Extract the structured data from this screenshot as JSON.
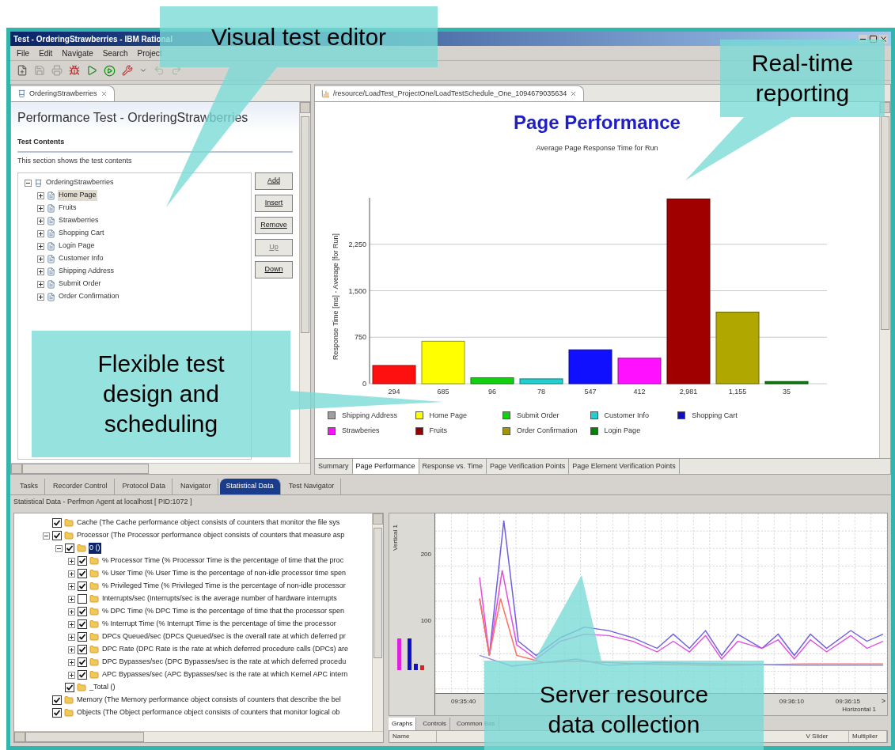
{
  "window": {
    "title": "Test - OrderingStrawberries - IBM Rational"
  },
  "menu": [
    "File",
    "Edit",
    "Navigate",
    "Search",
    "Project"
  ],
  "test_editor": {
    "tab": "OrderingStrawberries",
    "heading": "Performance Test - OrderingStrawberries",
    "section_title": "Test Contents",
    "section_description": "This section shows the test contents",
    "tree": {
      "label": "OrderingStrawberries",
      "expanded": true,
      "selected": false,
      "children": [
        {
          "label": "Home Page",
          "expanded": false,
          "selected": true
        },
        {
          "label": "Fruits",
          "expanded": false,
          "selected": false
        },
        {
          "label": "Strawberries",
          "expanded": false,
          "selected": false
        },
        {
          "label": "Shopping Cart",
          "expanded": false,
          "selected": false
        },
        {
          "label": "Login Page",
          "expanded": false,
          "selected": false
        },
        {
          "label": "Customer Info",
          "expanded": false,
          "selected": false
        },
        {
          "label": "Shipping Address",
          "expanded": false,
          "selected": false
        },
        {
          "label": "Submit Order",
          "expanded": false,
          "selected": false
        },
        {
          "label": "Order Confirmation",
          "expanded": false,
          "selected": false
        }
      ]
    },
    "buttons": [
      {
        "label": "Add",
        "disabled": false
      },
      {
        "label": "Insert",
        "disabled": false
      },
      {
        "label": "Remove",
        "disabled": false
      },
      {
        "label": "Up",
        "disabled": true
      },
      {
        "label": "Down",
        "disabled": false
      }
    ]
  },
  "report_editor": {
    "tab": "/resource/LoadTest_ProjectOne/LoadTestSchedule_One_1094679035634",
    "title": "Page Performance",
    "chart_data": {
      "type": "bar",
      "title": "Average Page Response Time for Run",
      "ylabel": "Response Time [ms] - Average [for Run]",
      "values": [
        294,
        685,
        96,
        78,
        547,
        412,
        2981,
        1155,
        35
      ],
      "value_labels": [
        "294",
        "685",
        "96",
        "78",
        "547",
        "412",
        "2,981",
        "1,155",
        "35"
      ],
      "ylim": [
        0,
        3000
      ],
      "grid": true,
      "yticks": [
        0,
        750,
        {
          "value": 1500,
          "label": "1,500"
        },
        {
          "value": 2250,
          "label": "2,250"
        }
      ]
    },
    "legend": [
      {
        "label": "Shipping Address",
        "color": "#a0a0a0"
      },
      {
        "label": "Home Page",
        "color": "#ffff00"
      },
      {
        "label": "Submit Order",
        "color": "#10d010"
      },
      {
        "label": "Customer Info",
        "color": "#20d0d0"
      },
      {
        "label": "Shopping Cart",
        "color": "#1010c0"
      },
      {
        "label": "Strawberies",
        "color": "#ff10ff"
      },
      {
        "label": "Fruits",
        "color": "#900000"
      },
      {
        "label": "Order Confirmation",
        "color": "#a09800"
      },
      {
        "label": "Login Page",
        "color": "#008000"
      }
    ],
    "tabs": [
      {
        "label": "Summary",
        "selected": false
      },
      {
        "label": "Page Performance",
        "selected": true
      },
      {
        "label": "Response vs. Time",
        "selected": false
      },
      {
        "label": "Page Verification Points",
        "selected": false
      },
      {
        "label": "Page Element Verification Points",
        "selected": false
      }
    ]
  },
  "bottom_panel": {
    "tabs": [
      {
        "label": "Tasks",
        "selected": false
      },
      {
        "label": "Recorder Control",
        "selected": false
      },
      {
        "label": "Protocol Data",
        "selected": false
      },
      {
        "label": "Navigator",
        "selected": false
      },
      {
        "label": "Statistical Data",
        "selected": true
      },
      {
        "label": "Test Navigator",
        "selected": false
      }
    ],
    "header": "Statistical Data - Perfmon Agent at localhost [ PID:1072 ]",
    "counters": [
      {
        "label": "Cache (The Cache performance object  consists of counters that monitor the file sys",
        "checked": true,
        "selected": false
      },
      {
        "label": "Processor (The Processor performance object consists of counters that measure asp",
        "checked": true,
        "selected": false,
        "expanded": true,
        "children": [
          {
            "label": "0 ()",
            "checked": true,
            "selected": true,
            "expanded": true,
            "children": [
              {
                "label": "% Processor Time (% Processor Time is the percentage of time that the proc",
                "checked": true,
                "selected": false,
                "expanded": false
              },
              {
                "label": "% User Time (% User Time is the percentage of non-idle processor time spen",
                "checked": true,
                "selected": false,
                "expanded": false
              },
              {
                "label": "% Privileged Time (% Privileged Time is the percentage of non-idle processor",
                "checked": true,
                "selected": false,
                "expanded": false
              },
              {
                "label": "Interrupts/sec (Interrupts/sec is the average number of hardware interrupts",
                "checked": false,
                "selected": false,
                "expanded": false
              },
              {
                "label": "% DPC Time (% DPC Time is the percentage of time that the processor spen",
                "checked": true,
                "selected": false,
                "expanded": false
              },
              {
                "label": "% Interrupt Time (% Interrupt Time is the percentage of time the processor",
                "checked": true,
                "selected": false,
                "expanded": false
              },
              {
                "label": "DPCs Queued/sec (DPCs Queued/sec is the overall rate at which deferred pr",
                "checked": true,
                "selected": false,
                "expanded": false
              },
              {
                "label": "DPC Rate (DPC Rate is the rate at which deferred procedure calls (DPCs) are",
                "checked": true,
                "selected": false,
                "expanded": false
              },
              {
                "label": "DPC Bypasses/sec (DPC Bypasses/sec is the rate at which deferred procedu",
                "checked": true,
                "selected": false,
                "expanded": false
              },
              {
                "label": "APC Bypasses/sec (APC Bypasses/sec is the rate at which Kernel APC intern",
                "checked": true,
                "selected": false,
                "expanded": false
              }
            ]
          },
          {
            "label": "_Total ()",
            "checked": true,
            "selected": false
          }
        ]
      },
      {
        "label": "Memory (The Memory performance object  consists of counters that describe the bel",
        "checked": true,
        "selected": false
      },
      {
        "label": "Objects (The Object performance object consists of counters that monitor  logical ob",
        "checked": true,
        "selected": false
      }
    ],
    "graph": {
      "y_axis_title": "Vertical 1",
      "y_labels": [
        "200",
        "100"
      ],
      "x_labels": [
        "09:35:40",
        "09:36:10",
        "09:36:15"
      ],
      "x_axis_title": "Horizontal 1",
      "scroll_mark": ">"
    },
    "graph_tabs": [
      {
        "label": "Graphs",
        "selected": true
      },
      {
        "label": "Controls",
        "selected": false
      },
      {
        "label": "Common Bas",
        "selected": false
      }
    ],
    "columns": [
      "Name",
      "V Slider",
      "Multiplier"
    ]
  },
  "callouts": [
    {
      "text": "Visual test editor"
    },
    {
      "text": "Real-time reporting"
    },
    {
      "text": "Flexible test design and scheduling"
    },
    {
      "text": "Server resource data collection"
    }
  ]
}
